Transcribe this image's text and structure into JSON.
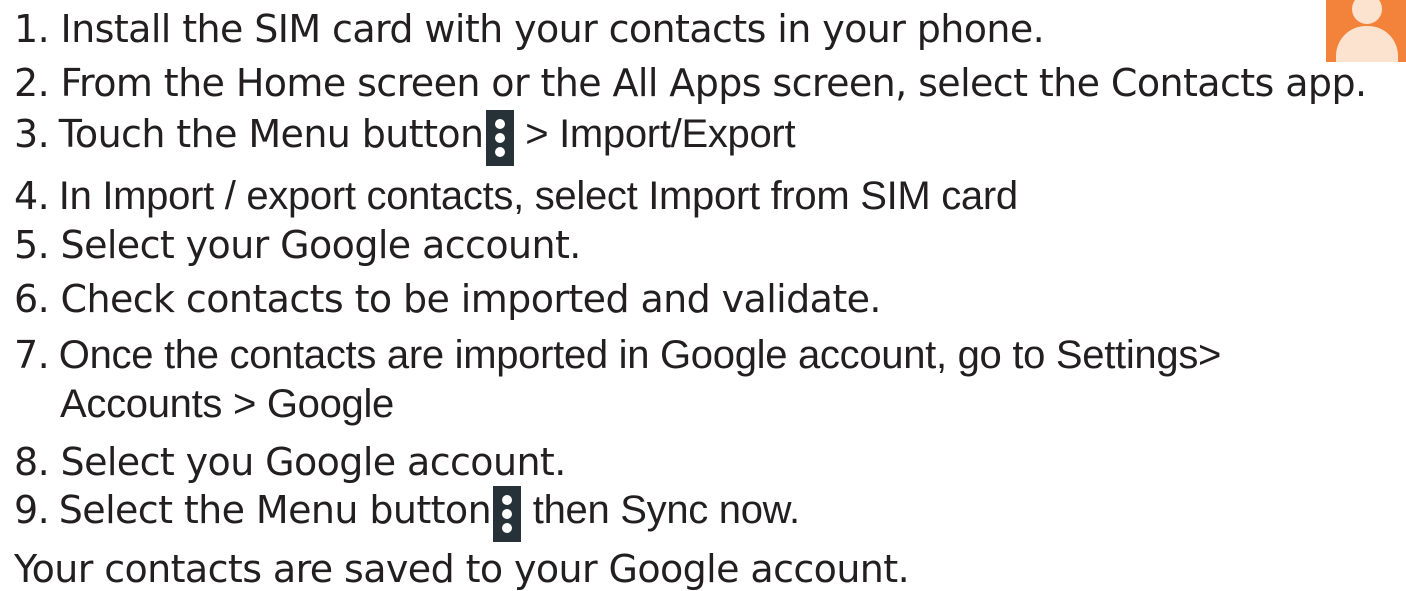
{
  "steps": [
    {
      "number": "1.",
      "text": "Install the SIM card with your contacts in your phone."
    },
    {
      "number": "2.",
      "text": "From the Home screen or the All Apps screen, select the Contacts app."
    },
    {
      "number": "3.",
      "text_before": "Touch the Menu button",
      "text_after": "> Import/Export"
    },
    {
      "number": "4.",
      "text": "In Import / export contacts, select Import from SIM card"
    },
    {
      "number": "5.",
      "text": "Select your Google account."
    },
    {
      "number": "6.",
      "text": "Check contacts to be imported and validate."
    },
    {
      "number": "7.",
      "text": "Once the contacts are imported in Google account, go to Settings>",
      "text_line2": "Accounts > Google"
    },
    {
      "number": "8.",
      "text": "Select you Google account."
    },
    {
      "number": "9.",
      "text_before": "Select the Menu button",
      "text_after": "then Sync now."
    }
  ],
  "closing": "Your contacts are saved to your Google account.",
  "icons": {
    "menu": "vertical-dots-menu-icon",
    "contacts": "contacts-app-icon"
  },
  "colors": {
    "text": "#231f20",
    "menu_icon_bg": "#263238",
    "contacts_icon_bg": "#f3823a"
  }
}
